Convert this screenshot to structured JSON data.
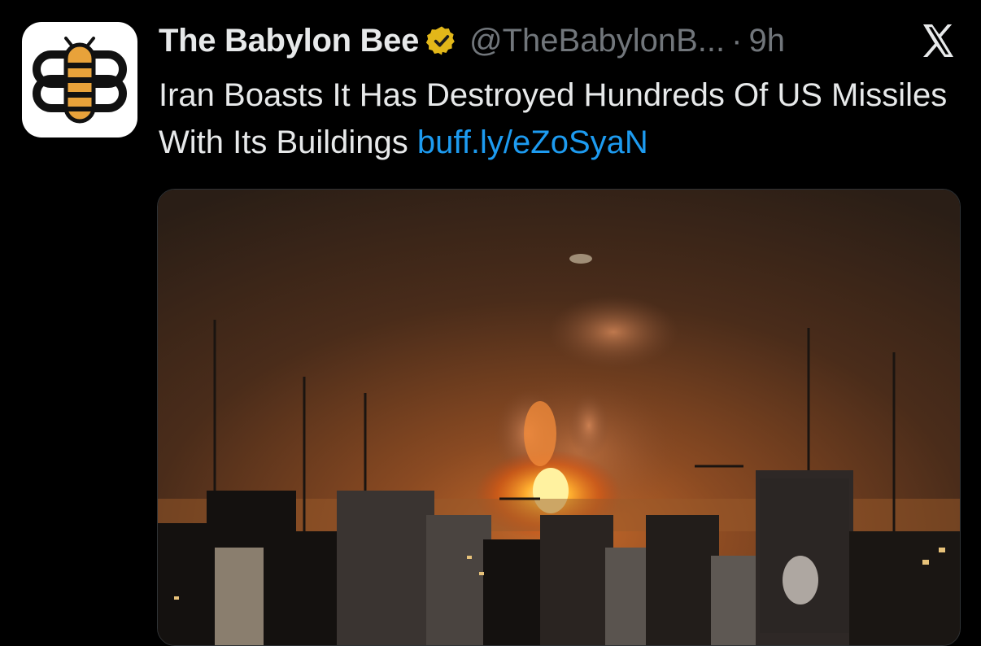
{
  "tweet": {
    "display_name": "The Babylon Bee",
    "handle": "@TheBabylonB...",
    "separator": "·",
    "timestamp": "9h",
    "text": "Iran Boasts It Has Destroyed Hundreds Of US Missiles With Its Buildings",
    "link": "buff.ly/eZoSyaN",
    "verified_color": "#e2b719",
    "link_color": "#1d9bf0"
  },
  "icons": {
    "avatar": "babylon-bee-logo",
    "verified": "verified-badge-icon",
    "platform": "x-logo-icon"
  }
}
